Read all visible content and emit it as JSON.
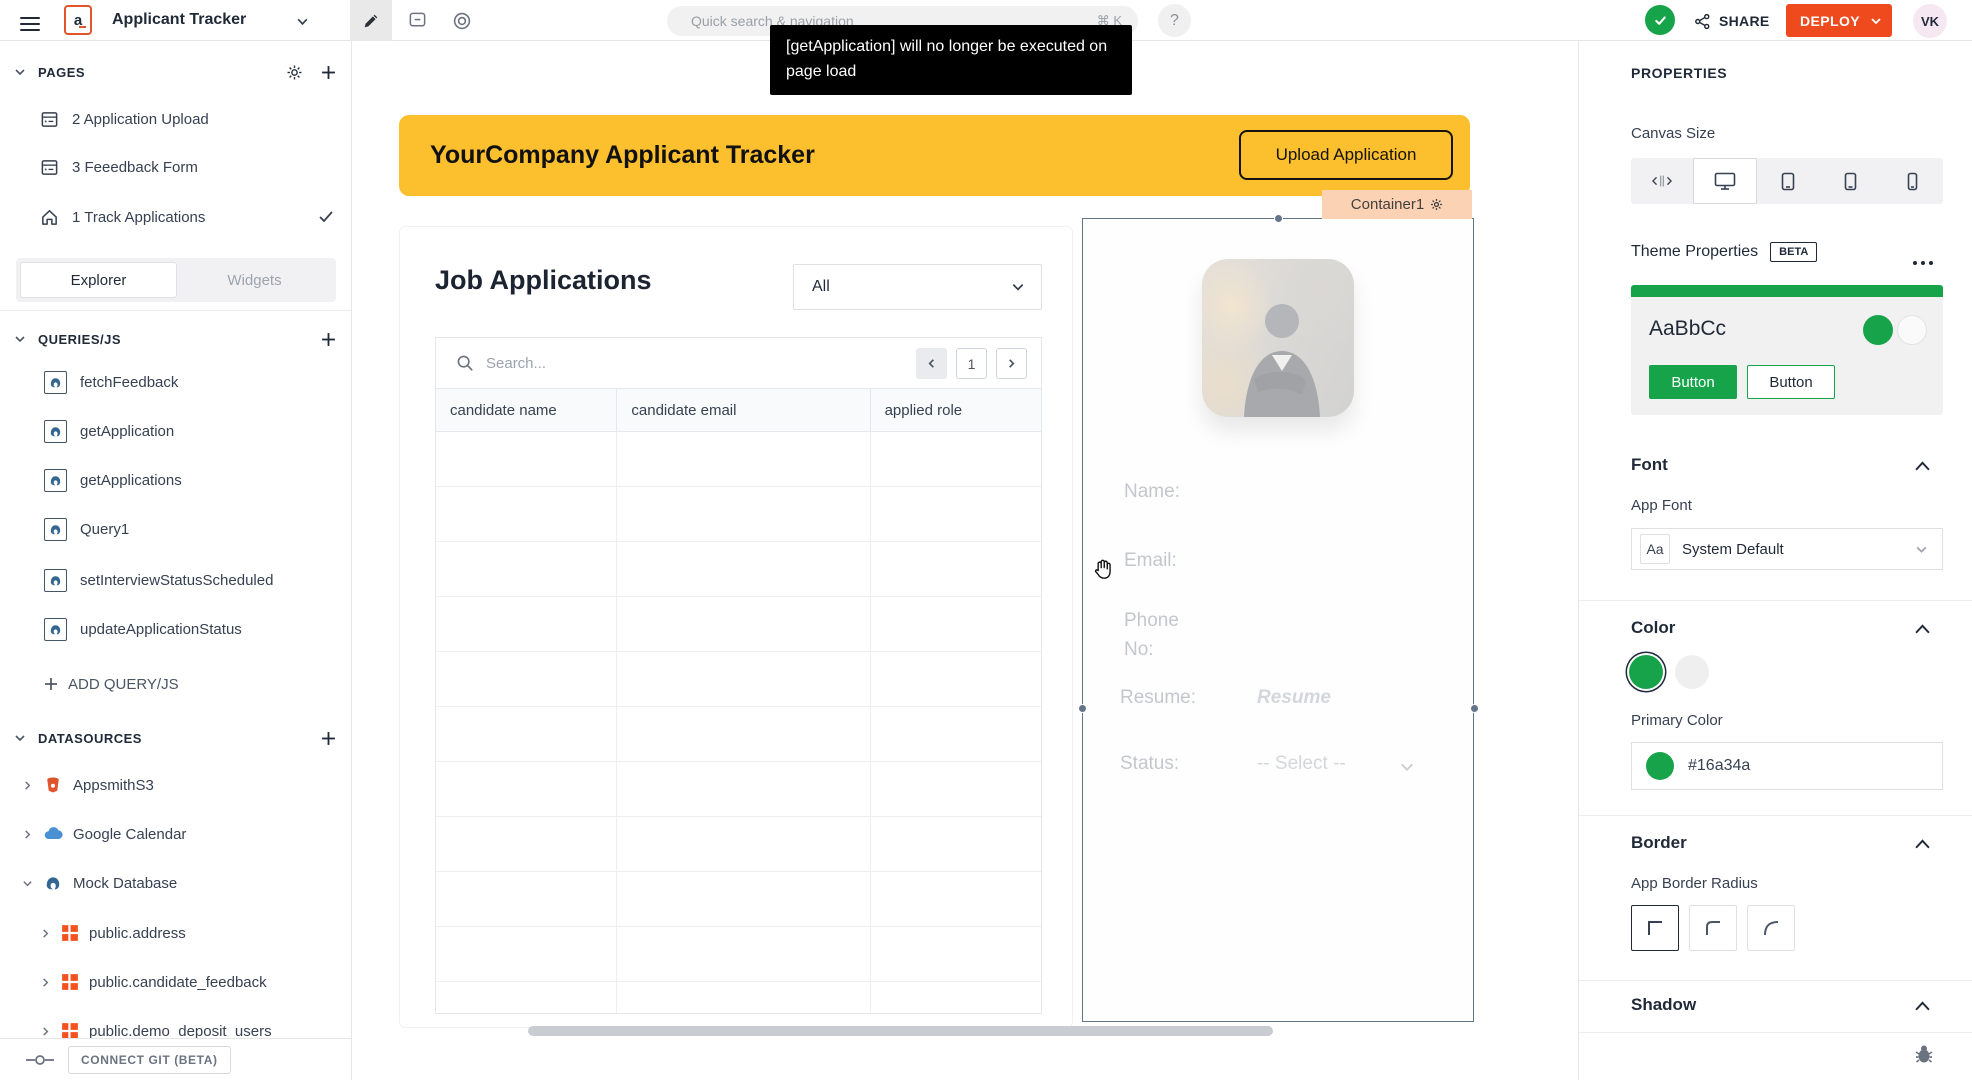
{
  "colors": {
    "accent_green": "#16a34a",
    "deploy_orange": "#ee4a1d",
    "header_yellow": "#fcbf2e",
    "tag_peach": "#fcd2b5"
  },
  "topbar": {
    "app_icon_letter": "a",
    "app_title": "Applicant Tracker",
    "search_placeholder": "Quick search & navigation",
    "search_shortcut": "⌘ K",
    "help_label": "?",
    "share_label": "SHARE",
    "deploy_label": "DEPLOY",
    "avatar_initials": "VK"
  },
  "toast": {
    "message": "[getApplication] will no longer be executed on page load"
  },
  "sidebar": {
    "pages": {
      "title": "PAGES",
      "items": [
        {
          "label": "2 Application Upload"
        },
        {
          "label": "3 Feeedback Form"
        },
        {
          "label": "1 Track Applications"
        }
      ]
    },
    "tabs": {
      "explorer": "Explorer",
      "widgets": "Widgets"
    },
    "queries": {
      "title": "QUERIES/JS",
      "items": [
        "fetchFeedback",
        "getApplication",
        "getApplications",
        "Query1",
        "setInterviewStatusScheduled",
        "updateApplicationStatus"
      ],
      "add_label": "ADD QUERY/JS"
    },
    "datasources": {
      "title": "DATASOURCES",
      "items": [
        "AppsmithS3",
        "Google Calendar",
        "Mock Database",
        "public.address",
        "public.candidate_feedback",
        "public.demo_deposit_users"
      ]
    },
    "git_label": "CONNECT GIT (BETA)"
  },
  "canvas": {
    "app_header": {
      "title": "YourCompany Applicant Tracker",
      "upload_button_label": "Upload Application"
    },
    "container_tag": "Container1",
    "table": {
      "title": "Job Applications",
      "filter_value": "All",
      "search_placeholder": "Search...",
      "page_number": "1",
      "columns": [
        "candidate name",
        "candidate email",
        "applied role"
      ],
      "empty_row_count": 11
    },
    "detail": {
      "name_label": "Name:",
      "email_label": "Email:",
      "phone_label": "Phone No:",
      "resume_label": "Resume:",
      "resume_value": "Resume",
      "status_label": "Status:",
      "status_placeholder": "-- Select --"
    }
  },
  "properties": {
    "title": "PROPERTIES",
    "canvas_size_label": "Canvas Size",
    "theme_properties_label": "Theme Properties",
    "beta_badge": "BETA",
    "theme_preview": {
      "sample_text": "AaBbCc",
      "primary_button": "Button",
      "secondary_button": "Button"
    },
    "font": {
      "section": "Font",
      "app_font_label": "App Font",
      "preview": "Aa",
      "value": "System Default"
    },
    "color": {
      "section": "Color",
      "primary_label": "Primary Color",
      "value": "#16a34a"
    },
    "border": {
      "section": "Border",
      "radius_label": "App Border Radius"
    },
    "shadow": {
      "section": "Shadow"
    }
  }
}
